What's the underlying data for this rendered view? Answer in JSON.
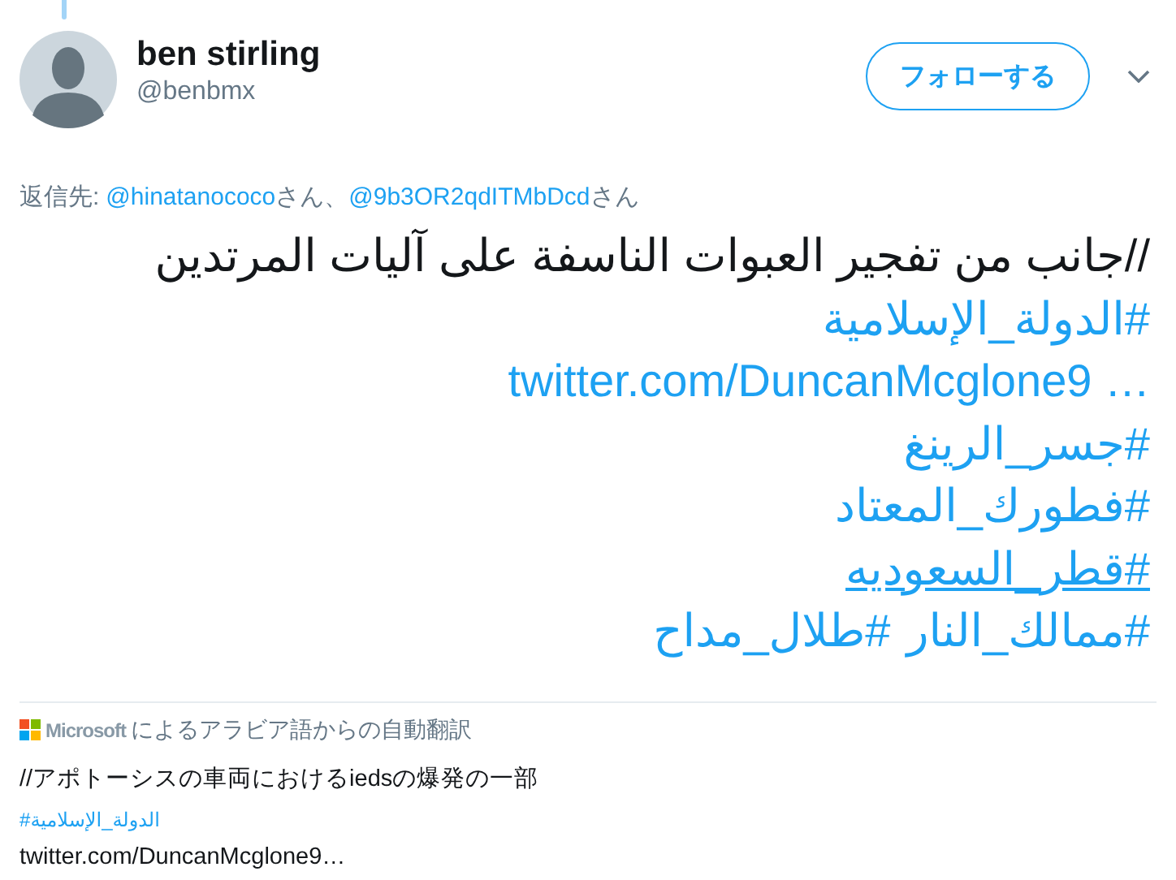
{
  "author": {
    "name": "ben stirling",
    "handle": "@benbmx"
  },
  "follow_button": {
    "label": "フォローする"
  },
  "reply_to": {
    "label": "返信先:",
    "first_mention": {
      "handle": "@hinatanococo",
      "suffix": "さん、"
    },
    "second_mention": {
      "handle": "@9b3OR2qdITMbDcd",
      "suffix": "さん"
    }
  },
  "tweet_lines": [
    {
      "segments": [
        {
          "kind": "text",
          "text": "//جانب من تفجير العبوات الناسفة على آليات المرتدين",
          "underlined": false
        }
      ]
    },
    {
      "segments": [
        {
          "kind": "hashtag",
          "text": "#الدولة_الإسلامية",
          "underlined": false
        }
      ]
    },
    {
      "segments": [
        {
          "kind": "link",
          "text": "twitter.com/DuncanMcglone9 …",
          "underlined": false
        }
      ]
    },
    {
      "segments": [
        {
          "kind": "hashtag",
          "text": "#جسر_الرينغ",
          "underlined": false
        }
      ]
    },
    {
      "segments": [
        {
          "kind": "hashtag",
          "text": "#فطورك_المعتاد",
          "underlined": false
        }
      ]
    },
    {
      "segments": [
        {
          "kind": "hashtag",
          "text": "#قطر_السعوديه",
          "underlined": true
        }
      ]
    },
    {
      "segments": [
        {
          "kind": "hashtag",
          "text": "#ممالك_النار",
          "underlined": false
        },
        {
          "kind": "hashtag",
          "text": "#طلال_مداح",
          "underlined": false
        }
      ]
    }
  ],
  "translation": {
    "provider": "Microsoft",
    "attribution": "によるアラビア語からの自動翻訳",
    "lines": [
      {
        "kind": "text",
        "text": "//アポトーシスの車両におけるiedsの爆発の一部"
      },
      {
        "kind": "hashtag",
        "text": "#الدولة_الإسلامية"
      },
      {
        "kind": "link",
        "text": "twitter.com/DuncanMcglone9…"
      }
    ]
  }
}
